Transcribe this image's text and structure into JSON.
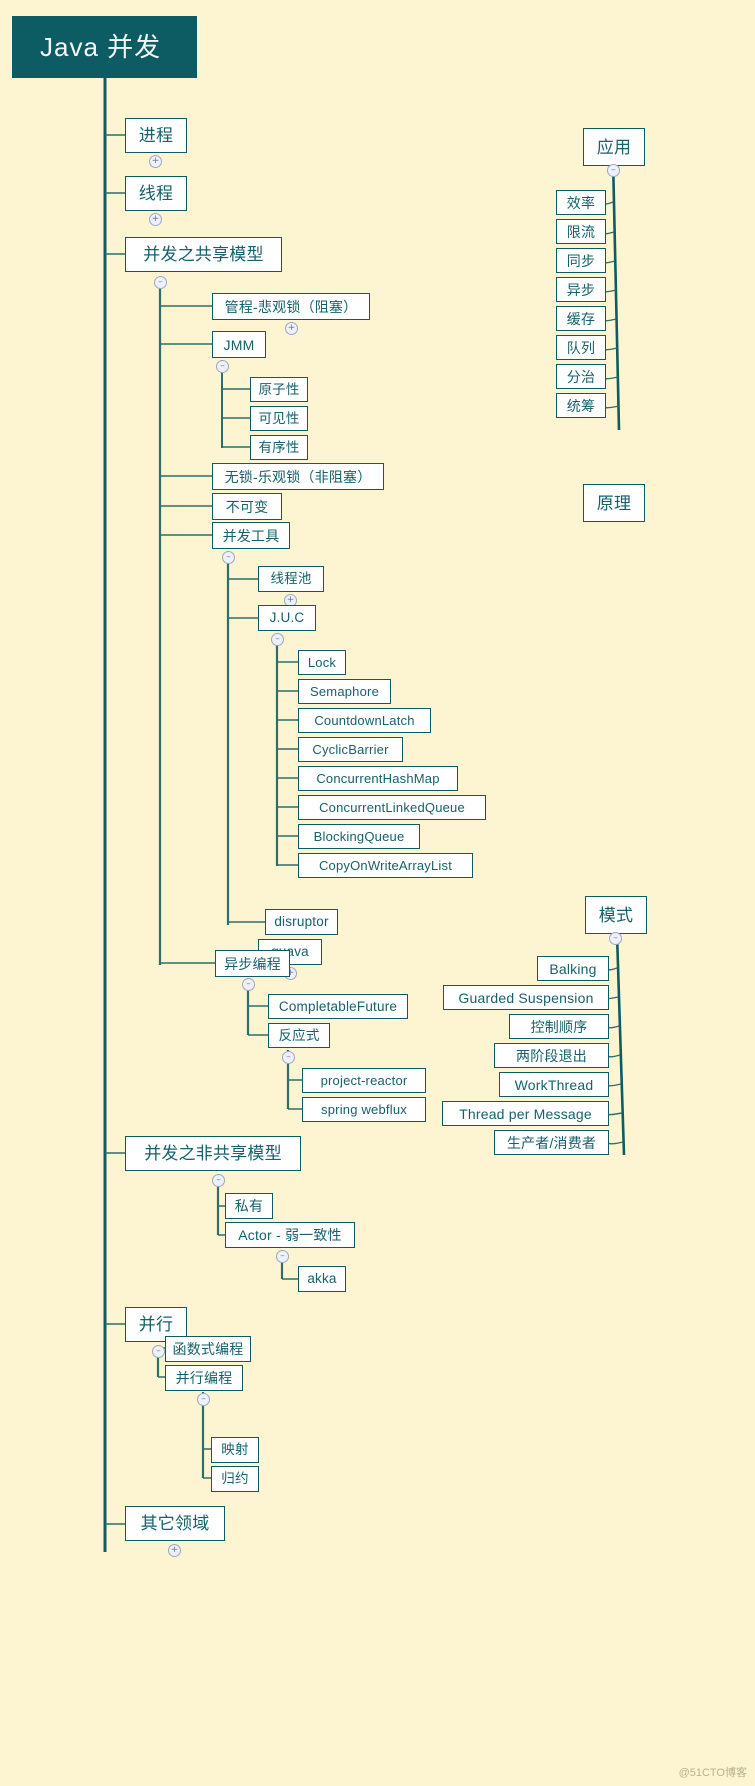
{
  "page": {
    "background_color": "#fdf5d2",
    "node_border_color": "#0d5b63",
    "node_text_color": "#16616b",
    "root_fill_color": "#0d5b63",
    "root_text_color": "#f2f8f7",
    "watermark": "@51CTO博客"
  },
  "root": {
    "label": "Java 并发"
  },
  "toggles": {
    "expanded": "–",
    "collapsed": "+"
  },
  "nodes": {
    "process": "进程",
    "thread": "线程",
    "shared_model": "并发之共享模型",
    "monitor_pessimistic": "管程-悲观锁（阻塞）",
    "jmm": "JMM",
    "atomicity": "原子性",
    "visibility": "可见性",
    "ordering": "有序性",
    "lockfree_optimistic": "无锁-乐观锁（非阻塞）",
    "immutable": "不可变",
    "concurrency_tools": "并发工具",
    "thread_pool": "线程池",
    "juc": "J.U.C",
    "lock": "Lock",
    "semaphore": "Semaphore",
    "countdown_latch": "CountdownLatch",
    "cyclic_barrier": "CyclicBarrier",
    "concurrent_hash_map": "ConcurrentHashMap",
    "concurrent_linked_queue": "ConcurrentLinkedQueue",
    "blocking_queue": "BlockingQueue",
    "copy_on_write_array_list": "CopyOnWriteArrayList",
    "disruptor": "disruptor",
    "guava": "guava",
    "async_programming": "异步编程",
    "completable_future": "CompletableFuture",
    "reactive": "反应式",
    "project_reactor": "project-reactor",
    "spring_webflux": "spring webflux",
    "non_shared_model": "并发之非共享模型",
    "private": "私有",
    "actor_weak_consistency": "Actor - 弱一致性",
    "akka": "akka",
    "parallel": "并行",
    "functional_programming": "函数式编程",
    "parallel_programming": "并行编程",
    "map": "映射",
    "reduce": "归约",
    "other_domains": "其它领域",
    "application": "应用",
    "efficiency": "效率",
    "rate_limiting": "限流",
    "synchronous": "同步",
    "asynchronous": "异步",
    "cache": "缓存",
    "queue": "队列",
    "divide_conquer": "分治",
    "coordination": "统筹",
    "principle": "原理",
    "pattern": "模式",
    "balking": "Balking",
    "guarded_suspension": "Guarded Suspension",
    "control_order": "控制顺序",
    "two_phase_termination": "两阶段退出",
    "work_thread": "WorkThread",
    "thread_per_message": "Thread per Message",
    "producer_consumer": "生产者/消费者"
  }
}
